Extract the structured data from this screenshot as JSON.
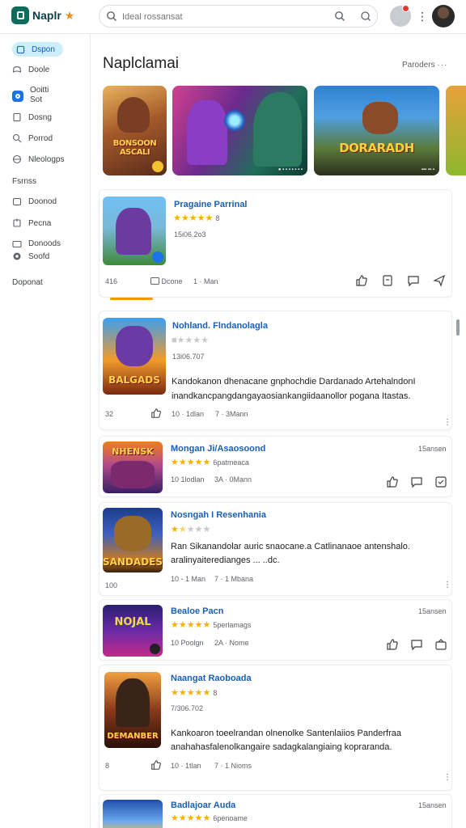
{
  "app": {
    "name": "Naplr",
    "star": "★"
  },
  "search": {
    "value": "",
    "placeholder": "Ideal rossansat"
  },
  "sidebar": {
    "items": [
      {
        "label": "Dspon"
      },
      {
        "label": "Doole"
      },
      {
        "label_line1": "Ooitti",
        "label_line2": "Sot"
      },
      {
        "label": "Dosng"
      },
      {
        "label": "Porrod"
      },
      {
        "label": "Nleologps"
      }
    ],
    "section1": "Fsrnss",
    "items2": [
      {
        "label": "Doonod"
      },
      {
        "label": "Pecna"
      },
      {
        "label_line1": "Donoods",
        "label_line2": "Soofd"
      }
    ],
    "section2": "Doponat"
  },
  "main": {
    "title": "Naplclamai",
    "section_link": "Paroders",
    "banners": [
      {
        "art": "BONSOON\nASCALI"
      },
      {
        "art": "",
        "caption": "● ▪ ▪ ▪ ▪ ▪ ▪ ▪"
      },
      {
        "art": "DORARADH",
        "caption": "▪▪▪ ▪▪ ▪"
      }
    ]
  },
  "featured": {
    "title": "Pragaine Parrinal",
    "rating_reviews": "8",
    "date": "15i06.2o3",
    "meta": {
      "count": "416",
      "comments": "Dcone",
      "author": "1 · Man"
    }
  },
  "cards": [
    {
      "title": "Nohland. Flndanolagla",
      "rating_reviews": "",
      "date": "13i06.707",
      "art": "BALGADS",
      "desc1": "Kandokanon dhenacane gnphochdie Dardanado ArtehalndonI",
      "desc2": "inandkancpangdangayaosiankangiidaanollor pogana Itastas.",
      "meta": {
        "count": "32",
        "likes": "10 · 1dlan",
        "comments": "7 · 3Mann"
      }
    },
    {
      "title": "Mongan Ji/Asaosoond",
      "rating_reviews": "6patmeaca",
      "time": "15ansen",
      "art": "NHENSK",
      "meta": {
        "likes": "10 1lodlan",
        "comments": "3A · 0Mann"
      }
    },
    {
      "title": "Nosngah I Resenhania",
      "rating_reviews": "",
      "art": "SANDADES",
      "desc1": "Ran Sikanandolar auric snaocane.a Catlinanaoe antenshalo.",
      "desc2": "aralinyaiteredianges ...  ..dc.",
      "meta": {
        "count": "100",
        "likes": "10 - 1 Man",
        "comments": "7 · 1 Mbana"
      }
    },
    {
      "title": "Bealoe Pacn",
      "rating_reviews": "5perlamags",
      "time": "15ansen",
      "art": "NOJAL",
      "meta": {
        "likes": "10 Poolgn",
        "comments": "2A · Nome"
      }
    },
    {
      "title": "Naangat Raoboada",
      "rating_reviews": "8",
      "date": "7/306.702",
      "art": "DEMANBER",
      "desc1": "Kankoaron toeelrandan olnenolke Santenlaiios Panderfraa",
      "desc2": "anahahasfalenolkangaire sadagkalangiaing kopraranda.",
      "meta": {
        "count": "8",
        "likes": "10 · 1tlan",
        "comments": "7 · 1 Nioms"
      }
    },
    {
      "title": "Badlajoar Auda",
      "rating_reviews": "6penoame",
      "time": "15ansen"
    }
  ],
  "colors": {
    "accent": "#1a73e8",
    "star": "#f6b100",
    "title_link": "#1a5fb4",
    "progress": "#f29900"
  }
}
